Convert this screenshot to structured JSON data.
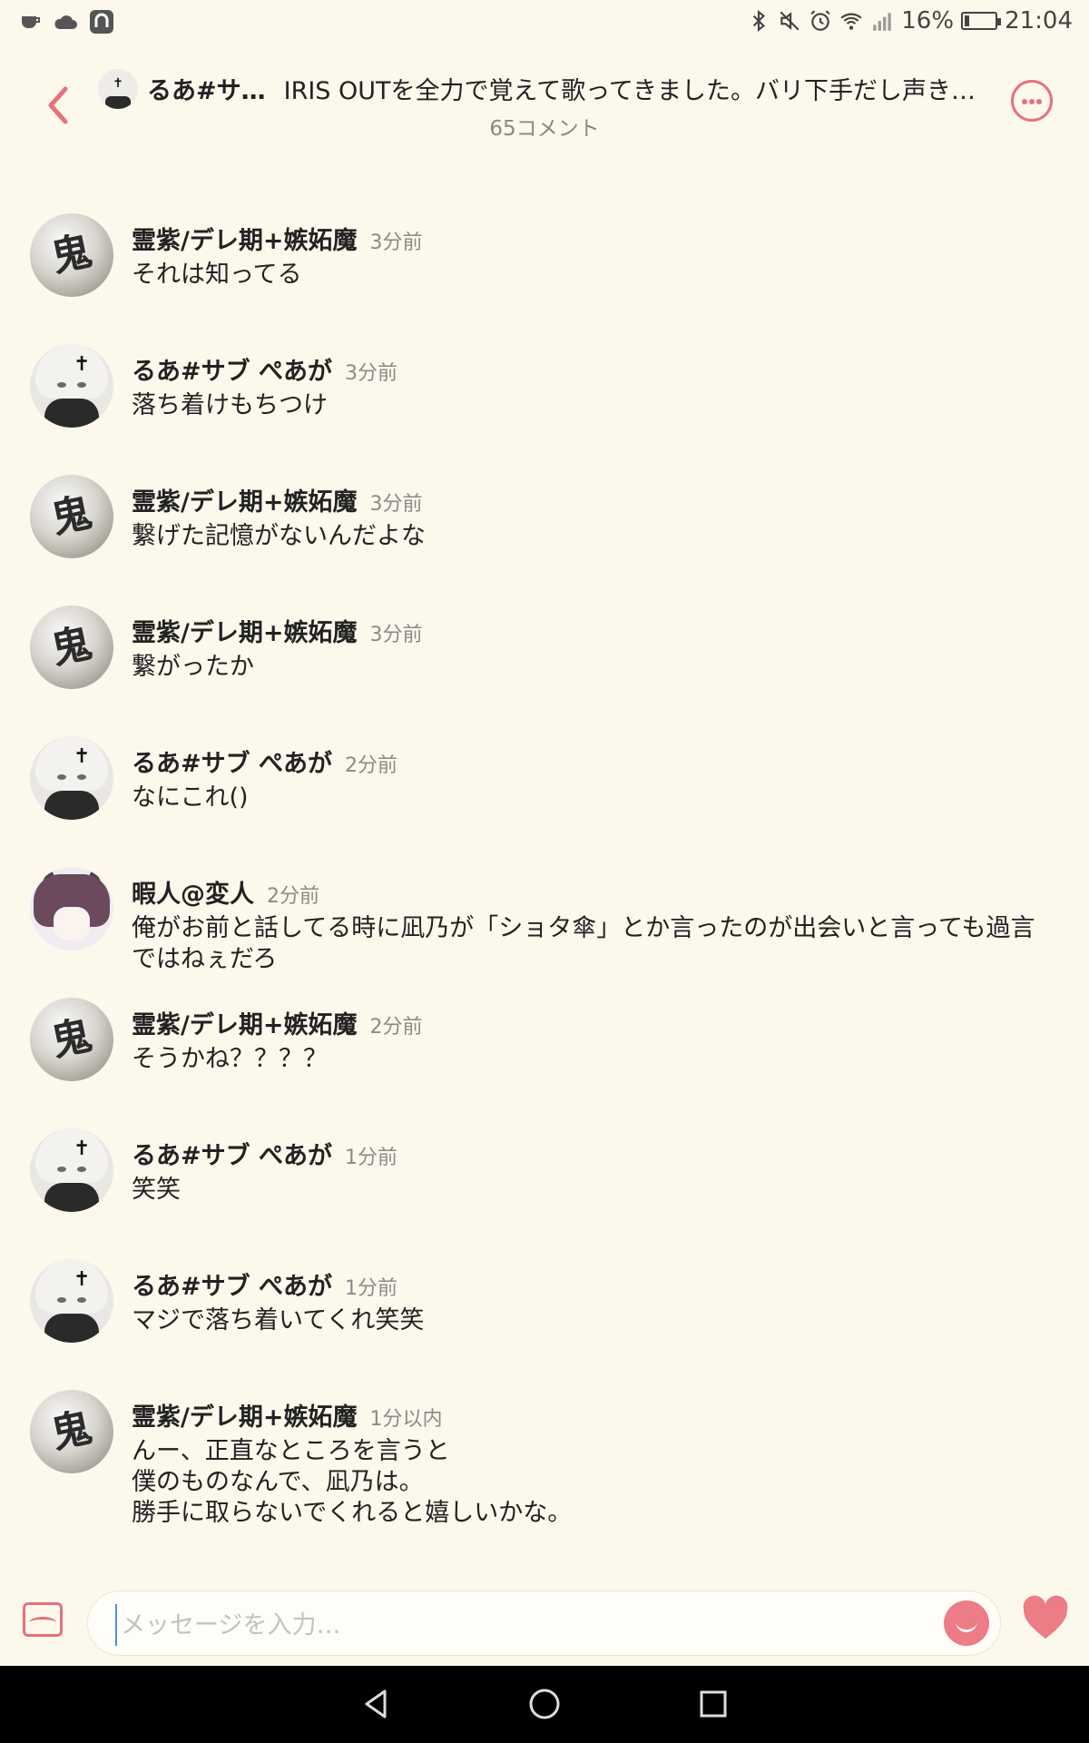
{
  "status_bar": {
    "battery_percent": "16%",
    "battery_level": 0.16,
    "time": "21:04",
    "left_icons": [
      "cup-icon",
      "cloud-icon",
      "app-icon"
    ],
    "right_icons": [
      "bluetooth-icon",
      "mute-icon",
      "alarm-icon",
      "wifi-icon",
      "signal-icon",
      "battery-icon"
    ]
  },
  "header": {
    "user": "るあ#サ…",
    "title": "IRIS OUTを全力で覚えて歌ってきました。バリ下手だし声き…",
    "comment_count": "65コメント"
  },
  "comments": [
    {
      "name": "霊紫/デレ期+嫉妬魔",
      "time": "3分前",
      "text": "それは知ってる",
      "avatar": "reisi"
    },
    {
      "name": "るあ#サブ ぺあが",
      "time": "3分前",
      "text": "落ち着けもちつけ",
      "avatar": "rua"
    },
    {
      "name": "霊紫/デレ期+嫉妬魔",
      "time": "3分前",
      "text": "繋げた記憶がないんだよな",
      "avatar": "reisi"
    },
    {
      "name": "霊紫/デレ期+嫉妬魔",
      "time": "3分前",
      "text": "繋がったか",
      "avatar": "reisi"
    },
    {
      "name": "るあ#サブ ぺあが",
      "time": "2分前",
      "text": "なにこれ()",
      "avatar": "rua"
    },
    {
      "name": "暇人@変人",
      "time": "2分前",
      "text": "俺がお前と話してる時に凪乃が「ショタ傘」とか言ったのが出会いと言っても過言\nではねぇだろ",
      "avatar": "hima"
    },
    {
      "name": "霊紫/デレ期+嫉妬魔",
      "time": "2分前",
      "text": "そうかね？？？？",
      "avatar": "reisi"
    },
    {
      "name": "るあ#サブ ぺあが",
      "time": "1分前",
      "text": "笑笑",
      "avatar": "rua"
    },
    {
      "name": "るあ#サブ ぺあが",
      "time": "1分前",
      "text": "マジで落ち着いてくれ笑笑",
      "avatar": "rua"
    },
    {
      "name": "霊紫/デレ期+嫉妬魔",
      "time": "1分以内",
      "text": "んー、正直なところを言うと\n僕のものなんで、凪乃は。\n勝手に取らないでくれると嬉しいかな。",
      "avatar": "reisi"
    }
  ],
  "composer": {
    "placeholder": "メッセージを入力…",
    "value": ""
  },
  "colors": {
    "background": "#fdf8ec",
    "accent": "#e8707c"
  }
}
